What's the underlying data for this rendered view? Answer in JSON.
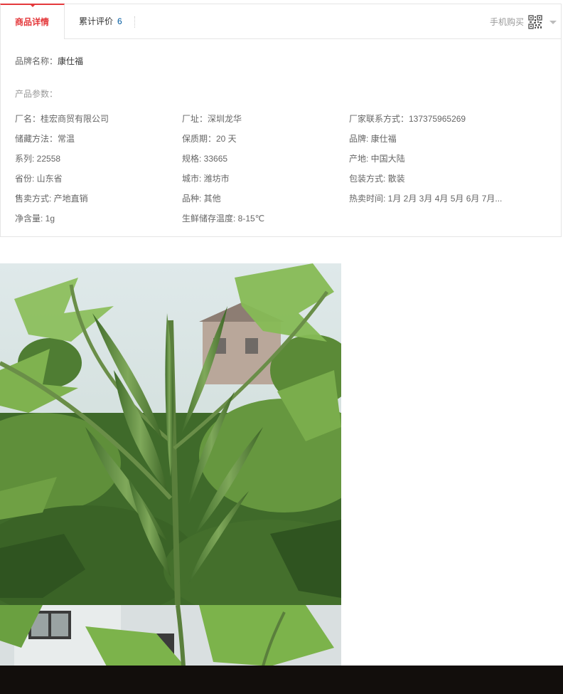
{
  "tabs": {
    "details_label": "商品详情",
    "reviews_label": "累计评价",
    "reviews_count": "6",
    "mobile_buy_label": "手机购买"
  },
  "brand": {
    "label": "品牌名称：",
    "value": "康仕福"
  },
  "params_title": "产品参数：",
  "params": [
    "厂名：桂宏商贸有限公司",
    "厂址：深圳龙华",
    "厂家联系方式：137375965269",
    "储藏方法：常温",
    "保质期：20 天",
    "品牌: 康仕福",
    "系列: 22558",
    "规格: 33665",
    "产地: 中国大陆",
    "省份: 山东省",
    "城市: 潍坊市",
    "包装方式: 散装",
    "售卖方式: 产地直销",
    "品种: 其他",
    "热卖时间: 1月 2月 3月 4月 5月 6月 7月...",
    "净含量: 1g",
    "生鲜储存温度: 8-15℃"
  ],
  "colors": {
    "accent": "#e4393c",
    "link": "#005aa0",
    "bottom_bar": "#120e0c"
  },
  "icons": {
    "qr": "qr-code-icon",
    "caret": "chevron-down-icon"
  }
}
